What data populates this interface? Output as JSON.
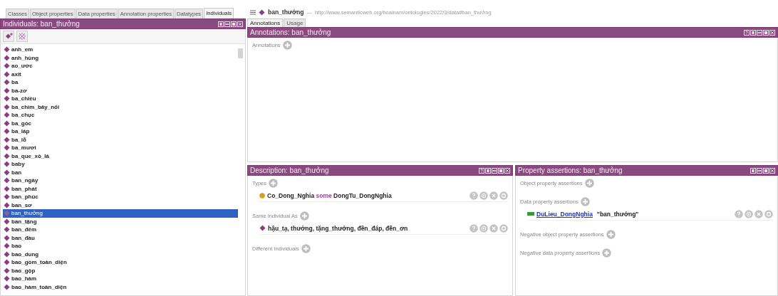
{
  "tabs": [
    {
      "label": "Classes",
      "selected": false
    },
    {
      "label": "Object properties",
      "selected": false
    },
    {
      "label": "Data properties",
      "selected": false
    },
    {
      "label": "Annotation properties",
      "selected": false
    },
    {
      "label": "Datatypes",
      "selected": false
    },
    {
      "label": "Individuals",
      "selected": true
    }
  ],
  "individuals_panel": {
    "title": "Individuals: ban_thưởng",
    "has_help": false,
    "items": [
      {
        "label": "anh_em",
        "selected": false
      },
      {
        "label": "anh_hùng",
        "selected": false
      },
      {
        "label": "ao_ước",
        "selected": false
      },
      {
        "label": "axit",
        "selected": false
      },
      {
        "label": "ba",
        "selected": false
      },
      {
        "label": "ba-zơ",
        "selected": false
      },
      {
        "label": "ba_chiều",
        "selected": false
      },
      {
        "label": "ba_chìm_bảy_nổi",
        "selected": false
      },
      {
        "label": "ba_chục",
        "selected": false
      },
      {
        "label": "ba_góc",
        "selected": false
      },
      {
        "label": "ba_láp",
        "selected": false
      },
      {
        "label": "ba_lỗ",
        "selected": false
      },
      {
        "label": "ba_mươi",
        "selected": false
      },
      {
        "label": "ba_que_xỏ_lá",
        "selected": false
      },
      {
        "label": "baby",
        "selected": false
      },
      {
        "label": "ban",
        "selected": false
      },
      {
        "label": "ban_ngày",
        "selected": false
      },
      {
        "label": "ban_phát",
        "selected": false
      },
      {
        "label": "ban_phúc",
        "selected": false
      },
      {
        "label": "ban_sơ",
        "selected": false
      },
      {
        "label": "ban_thưởng",
        "selected": true
      },
      {
        "label": "ban_tặng",
        "selected": false
      },
      {
        "label": "ban_đêm",
        "selected": false
      },
      {
        "label": "ban_đầu",
        "selected": false
      },
      {
        "label": "bao",
        "selected": false
      },
      {
        "label": "bao_dung",
        "selected": false
      },
      {
        "label": "bao_gồm_toàn_diện",
        "selected": false
      },
      {
        "label": "bao_gộp",
        "selected": false
      },
      {
        "label": "bao_hàm",
        "selected": false
      },
      {
        "label": "bao_hàm_toàn_diện",
        "selected": false
      }
    ]
  },
  "entity_header": {
    "name": "ban_thưởng",
    "separator": "—",
    "iri": "http://www.semanticweb.org/hoainam/ontologies/2022/3/data#ban_thưởng"
  },
  "entity_tabs": [
    {
      "label": "Annotations",
      "selected": true
    },
    {
      "label": "Usage",
      "selected": false
    }
  ],
  "annotations_panel": {
    "title": "Annotations: ban_thưởng",
    "has_help": true,
    "sections": [
      {
        "label": "Annotations"
      }
    ]
  },
  "description_panel": {
    "title": "Description: ban_thưởng",
    "has_help": true,
    "sections": [
      {
        "label": "Types",
        "entries": [
          {
            "kind": "class",
            "parts": [
              {
                "kind": "name",
                "text": "Co_Dong_Nghia"
              },
              {
                "kind": "keyword",
                "text": "some"
              },
              {
                "kind": "name",
                "text": "DongTu_DongNghia"
              }
            ]
          }
        ]
      },
      {
        "label": "Same Individual As",
        "entries": [
          {
            "kind": "individual",
            "parts": [
              {
                "kind": "name",
                "text": "hậu_tạ, thưởng, tặng_thưởng, đền_đáp, đền_ơn"
              }
            ]
          }
        ]
      },
      {
        "label": "Different Individuals"
      }
    ]
  },
  "property_panel": {
    "title": "Property assertions: ban_thưởng",
    "has_help": false,
    "sections": [
      {
        "label": "Object property assertions"
      },
      {
        "label": "Data property assertions",
        "entries": [
          {
            "kind": "data_property",
            "parts": [
              {
                "kind": "link",
                "text": "DuLieu_DongNghia"
              },
              {
                "kind": "name",
                "text": "\"ban_thưởng\""
              }
            ]
          }
        ]
      },
      {
        "label": "Negative object property assertions"
      },
      {
        "label": "Negative data property assertions"
      }
    ]
  }
}
